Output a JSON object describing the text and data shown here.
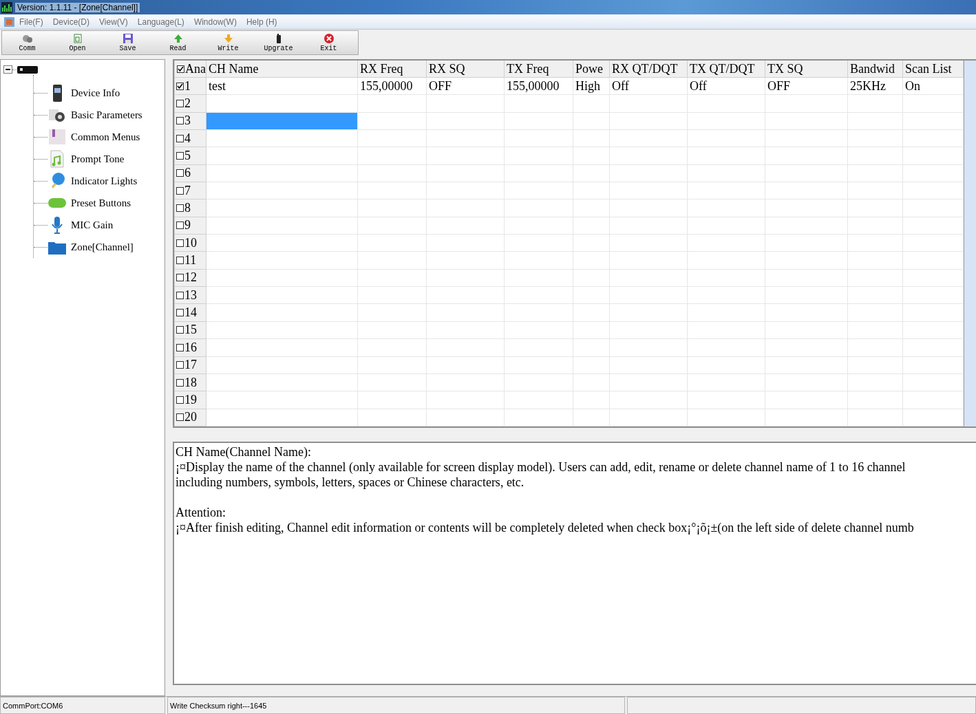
{
  "window": {
    "title": "Version: 1.1.11 - [Zone[Channel]]"
  },
  "menu": [
    "File(F)",
    "Device(D)",
    "View(V)",
    "Language(L)",
    "Window(W)",
    "Help (H)"
  ],
  "toolbar": [
    {
      "label": "Comm",
      "kind": "comm"
    },
    {
      "label": "Open",
      "kind": "open"
    },
    {
      "label": "Save",
      "kind": "save"
    },
    {
      "label": "Read",
      "kind": "read"
    },
    {
      "label": "Write",
      "kind": "write"
    },
    {
      "label": "Upgrate",
      "kind": "upgrade"
    },
    {
      "label": "Exit",
      "kind": "exit"
    }
  ],
  "tree": {
    "expanded": true,
    "children": [
      {
        "label": "Device Info",
        "kind": "radio"
      },
      {
        "label": "Basic Parameters",
        "kind": "gear"
      },
      {
        "label": "Common Menus",
        "kind": "book"
      },
      {
        "label": "Prompt Tone",
        "kind": "music"
      },
      {
        "label": "Indicator Lights",
        "kind": "bulb"
      },
      {
        "label": "Preset Buttons",
        "kind": "pill"
      },
      {
        "label": "MIC Gain",
        "kind": "mic"
      },
      {
        "label": "Zone[Channel]",
        "kind": "folder"
      }
    ]
  },
  "table": {
    "header_checked": true,
    "columns": [
      "Ana",
      "CH Name",
      "RX Freq",
      "RX SQ",
      "TX Freq",
      "Powe",
      "RX QT/DQT",
      "TX QT/DQT",
      "TX SQ",
      "Bandwid",
      "Scan List"
    ],
    "rows": [
      {
        "number": "1",
        "checked": true,
        "selected": false,
        "cells": [
          "test",
          "155,00000",
          "OFF",
          "155,00000",
          "High",
          "Off",
          "Off",
          "OFF",
          "25KHz",
          "On"
        ]
      },
      {
        "number": "2",
        "checked": false,
        "selected": false
      },
      {
        "number": "3",
        "checked": false,
        "selected": true
      },
      {
        "number": "4",
        "checked": false,
        "selected": false
      },
      {
        "number": "5",
        "checked": false,
        "selected": false
      },
      {
        "number": "6",
        "checked": false,
        "selected": false
      },
      {
        "number": "7",
        "checked": false,
        "selected": false
      },
      {
        "number": "8",
        "checked": false,
        "selected": false
      },
      {
        "number": "9",
        "checked": false,
        "selected": false
      },
      {
        "number": "10",
        "checked": false,
        "selected": false
      },
      {
        "number": "11",
        "checked": false,
        "selected": false
      },
      {
        "number": "12",
        "checked": false,
        "selected": false
      },
      {
        "number": "13",
        "checked": false,
        "selected": false
      },
      {
        "number": "14",
        "checked": false,
        "selected": false
      },
      {
        "number": "15",
        "checked": false,
        "selected": false
      },
      {
        "number": "16",
        "checked": false,
        "selected": false
      },
      {
        "number": "17",
        "checked": false,
        "selected": false
      },
      {
        "number": "18",
        "checked": false,
        "selected": false
      },
      {
        "number": "19",
        "checked": false,
        "selected": false
      },
      {
        "number": "20",
        "checked": false,
        "selected": false
      }
    ]
  },
  "description": [
    {
      "heading": "CH Name(Channel Name):",
      "lines": [
        "¡¤Display the name of the channel (only available for screen display model). Users can add, edit, rename or delete channel name of 1 to 16 channel",
        "including numbers, symbols, letters, spaces or Chinese characters, etc."
      ]
    },
    {
      "heading": "Attention:",
      "lines": [
        "¡¤After finish editing, Channel edit information or contents will be completely deleted when check box¡°¡õ¡±(on the left side of delete channel numb"
      ]
    }
  ],
  "status_bar": [
    "CommPort:COM6",
    "Write Checksum right---1645"
  ]
}
